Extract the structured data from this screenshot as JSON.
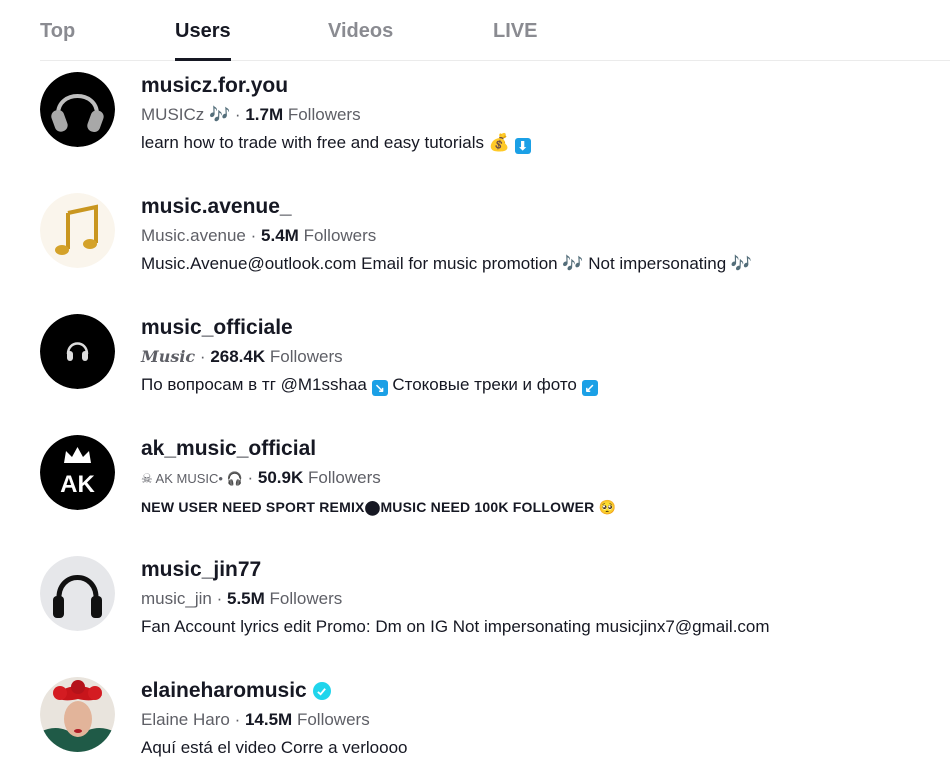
{
  "tabs": [
    {
      "label": "Top",
      "active": false
    },
    {
      "label": "Users",
      "active": true
    },
    {
      "label": "Videos",
      "active": false
    },
    {
      "label": "LIVE",
      "active": false
    }
  ],
  "users": [
    {
      "username": "musicz.for.you",
      "nickname": "MUSICz 🎶",
      "followers": "1.7M",
      "followers_label": "Followers",
      "bio": "learn how to trade with free and easy tutorials",
      "bio_emoji_1": "💰",
      "bio_emoji_2": "⬇",
      "avatar_icon": "headphones-icon"
    },
    {
      "username": "music.avenue_",
      "nickname": "Music.avenue",
      "followers": "5.4M",
      "followers_label": "Followers",
      "bio": "Music.Avenue@outlook.com Email for music promotion 🎶  Not impersonating 🎶",
      "avatar_icon": "music-note-icon"
    },
    {
      "username": "music_officiale",
      "nickname": "Music",
      "followers": "268.4K",
      "followers_label": "Followers",
      "bio_part_1": "По вопросам в тг @M1sshaa",
      "bio_arrow_1": "↘",
      "bio_part_2": "Стоковые треки и фото",
      "bio_arrow_2": "↙",
      "avatar_icon": "headphones-icon"
    },
    {
      "username": "ak_music_official",
      "nickname": "☠ AK MUSIC• 🎧",
      "followers": "50.9K",
      "followers_label": "Followers",
      "bio": "NEW USER NEED SPORT REMIX⬤MUSIC NEED 100K FOLLOWER",
      "bio_emoji": "🥺",
      "avatar_text": "AK",
      "avatar_icon": "crown-icon"
    },
    {
      "username": "music_jin77",
      "nickname": "music_jin",
      "followers": "5.5M",
      "followers_label": "Followers",
      "bio": "Fan Account lyrics edit Promo: Dm on IG Not impersonating musicjinx7@gmail.com",
      "avatar_icon": "headphones-icon"
    },
    {
      "username": "elaineharomusic",
      "verified": true,
      "nickname": "Elaine Haro",
      "followers": "14.5M",
      "followers_label": "Followers",
      "bio": "Aquí está el video Corre a verloooo",
      "avatar_icon": "profile-photo"
    }
  ],
  "separator": "·"
}
